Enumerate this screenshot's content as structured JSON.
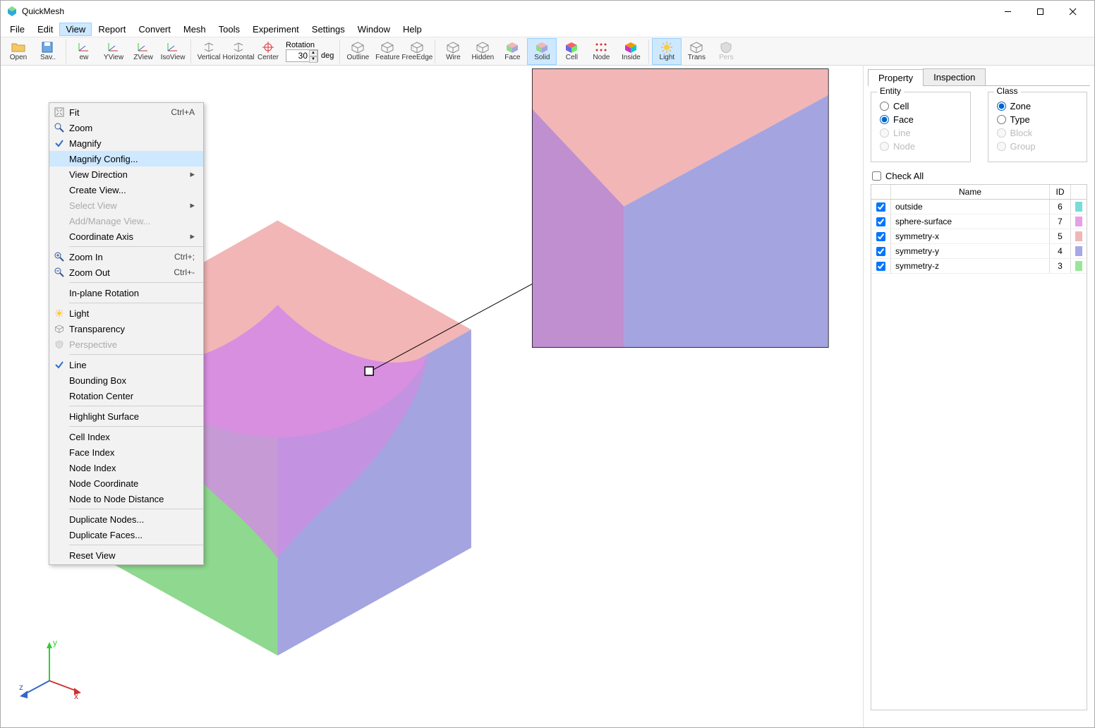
{
  "window": {
    "title": "QuickMesh"
  },
  "menubar": [
    "File",
    "Edit",
    "View",
    "Report",
    "Convert",
    "Mesh",
    "Tools",
    "Experiment",
    "Settings",
    "Window",
    "Help"
  ],
  "menubar_open_index": 2,
  "toolbar": {
    "items": [
      {
        "name": "open",
        "label": "Open"
      },
      {
        "name": "save",
        "label": "Sav.."
      },
      {
        "name": "sep"
      },
      {
        "name": "fit",
        "label": "ew"
      },
      {
        "name": "yview",
        "label": "YView"
      },
      {
        "name": "zview",
        "label": "ZView"
      },
      {
        "name": "isoview",
        "label": "IsoView"
      },
      {
        "name": "sep"
      },
      {
        "name": "vertical",
        "label": "Vertical"
      },
      {
        "name": "horizontal",
        "label": "Horizontal"
      },
      {
        "name": "center",
        "label": "Center"
      }
    ],
    "rotation_label": "Rotation",
    "rotation_value": "30",
    "rotation_unit": "deg",
    "items2": [
      {
        "name": "outline",
        "label": "Outline"
      },
      {
        "name": "feature",
        "label": "Feature"
      },
      {
        "name": "freeedge",
        "label": "FreeEdge"
      },
      {
        "name": "sep"
      },
      {
        "name": "wire",
        "label": "Wire"
      },
      {
        "name": "hidden",
        "label": "Hidden"
      },
      {
        "name": "face",
        "label": "Face"
      },
      {
        "name": "solid",
        "label": "Solid",
        "sel": true
      },
      {
        "name": "cell",
        "label": "Cell"
      },
      {
        "name": "node",
        "label": "Node"
      },
      {
        "name": "inside",
        "label": "Inside"
      },
      {
        "name": "sep"
      },
      {
        "name": "light",
        "label": "Light",
        "sel": true
      },
      {
        "name": "trans",
        "label": "Trans"
      },
      {
        "name": "pers",
        "label": "Pers",
        "disabled": true
      }
    ]
  },
  "dropdown": {
    "sections": [
      [
        {
          "icon": "fit",
          "label": "Fit",
          "shortcut": "Ctrl+A"
        },
        {
          "icon": "zoom",
          "label": "Zoom"
        },
        {
          "icon": "check",
          "label": "Magnify"
        },
        {
          "label": "Magnify Config...",
          "highlight": true
        },
        {
          "label": "View Direction",
          "submenu": true
        },
        {
          "label": "Create View..."
        },
        {
          "label": "Select View",
          "submenu": true,
          "disabled": true
        },
        {
          "label": "Add/Manage View...",
          "disabled": true
        },
        {
          "label": "Coordinate Axis",
          "submenu": true
        }
      ],
      [
        {
          "icon": "zoomin",
          "label": "Zoom In",
          "shortcut": "Ctrl+;"
        },
        {
          "icon": "zoomout",
          "label": "Zoom Out",
          "shortcut": "Ctrl+-"
        }
      ],
      [
        {
          "label": "In-plane Rotation"
        }
      ],
      [
        {
          "icon": "sun",
          "label": "Light"
        },
        {
          "icon": "cube",
          "label": "Transparency"
        },
        {
          "icon": "shield",
          "label": "Perspective",
          "disabled": true
        }
      ],
      [
        {
          "icon": "check",
          "label": "Line"
        },
        {
          "label": "Bounding Box"
        },
        {
          "label": "Rotation Center"
        }
      ],
      [
        {
          "label": "Highlight Surface"
        }
      ],
      [
        {
          "label": "Cell Index"
        },
        {
          "label": "Face Index"
        },
        {
          "label": "Node Index"
        },
        {
          "label": "Node Coordinate"
        },
        {
          "label": "Node to Node Distance"
        }
      ],
      [
        {
          "label": "Duplicate Nodes..."
        },
        {
          "label": "Duplicate Faces..."
        }
      ],
      [
        {
          "label": "Reset View"
        }
      ]
    ]
  },
  "side": {
    "tabs": [
      "Property",
      "Inspection"
    ],
    "active_tab": 0,
    "entity_label": "Entity",
    "class_label": "Class",
    "entity": [
      {
        "label": "Cell",
        "checked": false
      },
      {
        "label": "Face",
        "checked": true
      },
      {
        "label": "Line",
        "checked": false,
        "disabled": true
      },
      {
        "label": "Node",
        "checked": false,
        "disabled": true
      }
    ],
    "class": [
      {
        "label": "Zone",
        "checked": true
      },
      {
        "label": "Type",
        "checked": false
      },
      {
        "label": "Block",
        "checked": false,
        "disabled": true
      },
      {
        "label": "Group",
        "checked": false,
        "disabled": true
      }
    ],
    "checkall_label": "Check All",
    "table": {
      "headers": [
        "Name",
        "ID"
      ],
      "rows": [
        {
          "name": "outside",
          "id": "6",
          "color": "#7adcd9"
        },
        {
          "name": "sphere-surface",
          "id": "7",
          "color": "#e6a0e6"
        },
        {
          "name": "symmetry-x",
          "id": "5",
          "color": "#f2b6b6"
        },
        {
          "name": "symmetry-y",
          "id": "4",
          "color": "#a8a8e6"
        },
        {
          "name": "symmetry-z",
          "id": "3",
          "color": "#99e699"
        }
      ]
    }
  },
  "axis": {
    "x": "x",
    "y": "y",
    "z": "z"
  }
}
